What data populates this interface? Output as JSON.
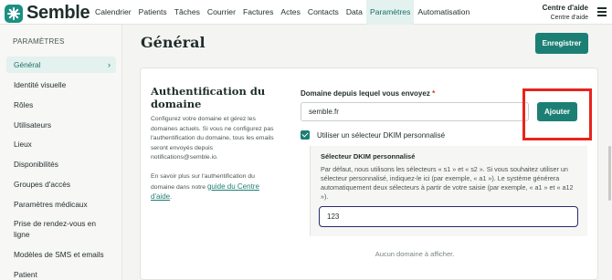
{
  "app": {
    "name": "Semble"
  },
  "nav": {
    "items": [
      "Calendrier",
      "Patients",
      "Tâches",
      "Courrier",
      "Factures",
      "Actes",
      "Contacts",
      "Data",
      "Paramètres",
      "Automatisation"
    ],
    "active": "Paramètres"
  },
  "help": {
    "title": "Centre d'aide",
    "subtitle": "Centre d'aide"
  },
  "sidebar": {
    "title": "PARAMÈTRES",
    "items": [
      {
        "label": "Général",
        "active": true
      },
      {
        "label": "Identité visuelle"
      },
      {
        "label": "Rôles"
      },
      {
        "label": "Utilisateurs"
      },
      {
        "label": "Lieux"
      },
      {
        "label": "Disponibilités"
      },
      {
        "label": "Groupes d'accès"
      },
      {
        "label": "Paramètres médicaux"
      },
      {
        "label": "Prise de rendez-vous en ligne"
      },
      {
        "label": "Modèles de SMS et emails"
      },
      {
        "label": "Patient"
      }
    ]
  },
  "page": {
    "title": "Général",
    "save_label": "Enregistrer"
  },
  "auth_section": {
    "title": "Authentification du domaine",
    "description": "Configurez votre domaine et gérez les domaines actuels. Si vous ne configurez pas l'authentification du domaine, tous les emails seront envoyés depuis notifications@semble.io.",
    "help_prefix": "En savoir plus sur l'authentification du domaine dans notre",
    "help_link": "guide du Centre d'aide",
    "help_suffix": "."
  },
  "domain_form": {
    "label": "Domaine depuis lequel vous envoyez",
    "required_mark": "*",
    "value": "semble.fr",
    "add_label": "Ajouter",
    "dkim_checkbox_label": "Utiliser un sélecteur DKIM personnalisé",
    "dkim_checked": true,
    "dkim_title": "Sélecteur DKIM personnalisé",
    "dkim_description": "Par défaut, nous utilisons les sélecteurs « s1 » et « s2 ». Si vous souhaitez utiliser un sélecteur personnalisé, indiquez-le ici (par exemple, « a1 »). Le système générera automatiquement deux sélecteurs à partir de votre saisie (par exemple, « a1 » et « a12 »).",
    "dkim_value": "123",
    "empty_text": "Aucun domaine à afficher."
  },
  "colors": {
    "brand": "#1c7f74",
    "highlight": "#e8241c",
    "active_bg": "#e3f1ef"
  }
}
